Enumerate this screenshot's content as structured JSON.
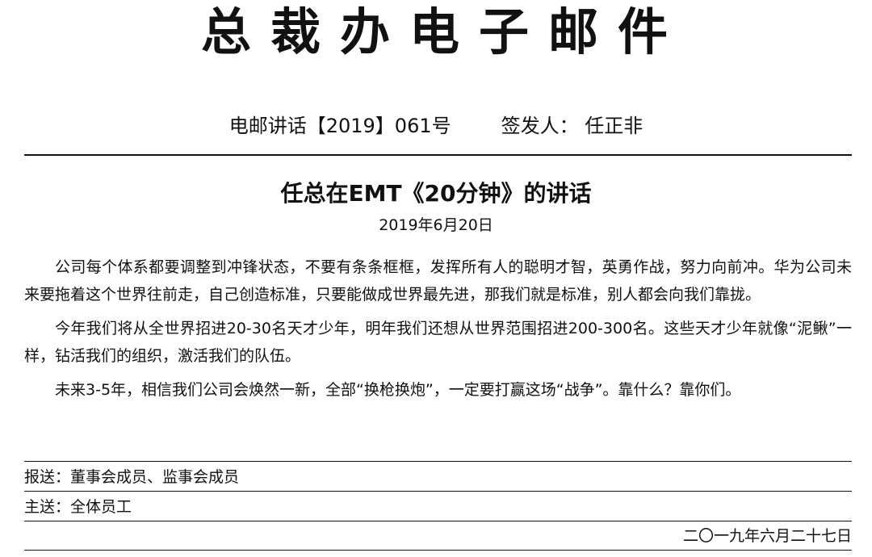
{
  "header": {
    "masthead": "总裁办电子邮件",
    "doc_number": "电邮讲话【2019】061号",
    "issuer": "签发人：  任正非"
  },
  "article": {
    "title": "任总在EMT《20分钟》的讲话",
    "date": "2019年6月20日",
    "paragraphs": [
      "公司每个体系都要调整到冲锋状态，不要有条条框框，发挥所有人的聪明才智，英勇作战，努力向前冲。华为公司未来要拖着这个世界往前走，自己创造标准，只要能做成世界最先进，那我们就是标准，别人都会向我们靠拢。",
      "今年我们将从全世界招进20-30名天才少年，明年我们还想从世界范围招进200-300名。这些天才少年就像“泥鳅”一样，钻活我们的组织，激活我们的队伍。",
      "未来3-5年，相信我们公司会焕然一新，全部“换枪换炮”，一定要打赢这场“战争”。靠什么？靠你们。"
    ]
  },
  "footer": {
    "report_to": "报送：董事会成员、监事会成员",
    "send_to": "主送：全体员工",
    "issue_date": "二〇一九年六月二十七日"
  }
}
